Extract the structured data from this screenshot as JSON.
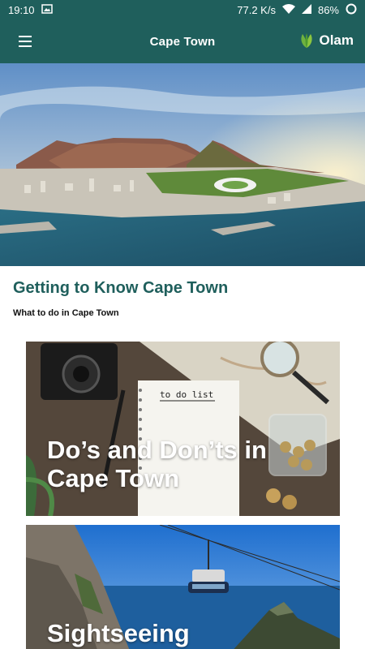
{
  "status_bar": {
    "time": "19:10",
    "network_speed": "77.2 K/s",
    "battery": "86%"
  },
  "app_bar": {
    "title": "Cape Town",
    "brand": "Olam",
    "menu_icon": "hamburger-menu-icon"
  },
  "hero": {
    "image": "cape-town-aerial-table-mountain-image"
  },
  "section": {
    "title": "Getting to Know Cape Town",
    "subtitle": "What to do in Cape Town"
  },
  "cards": [
    {
      "title": "Do’s and Don’ts in Cape Town",
      "note_text": "to do list",
      "image": "to-do-list-desk-image"
    },
    {
      "title": "Sightseeing",
      "image": "table-mountain-cableway-image"
    }
  ],
  "colors": {
    "primary": "#1f5f5c",
    "brand_green": "#6fb23f"
  }
}
